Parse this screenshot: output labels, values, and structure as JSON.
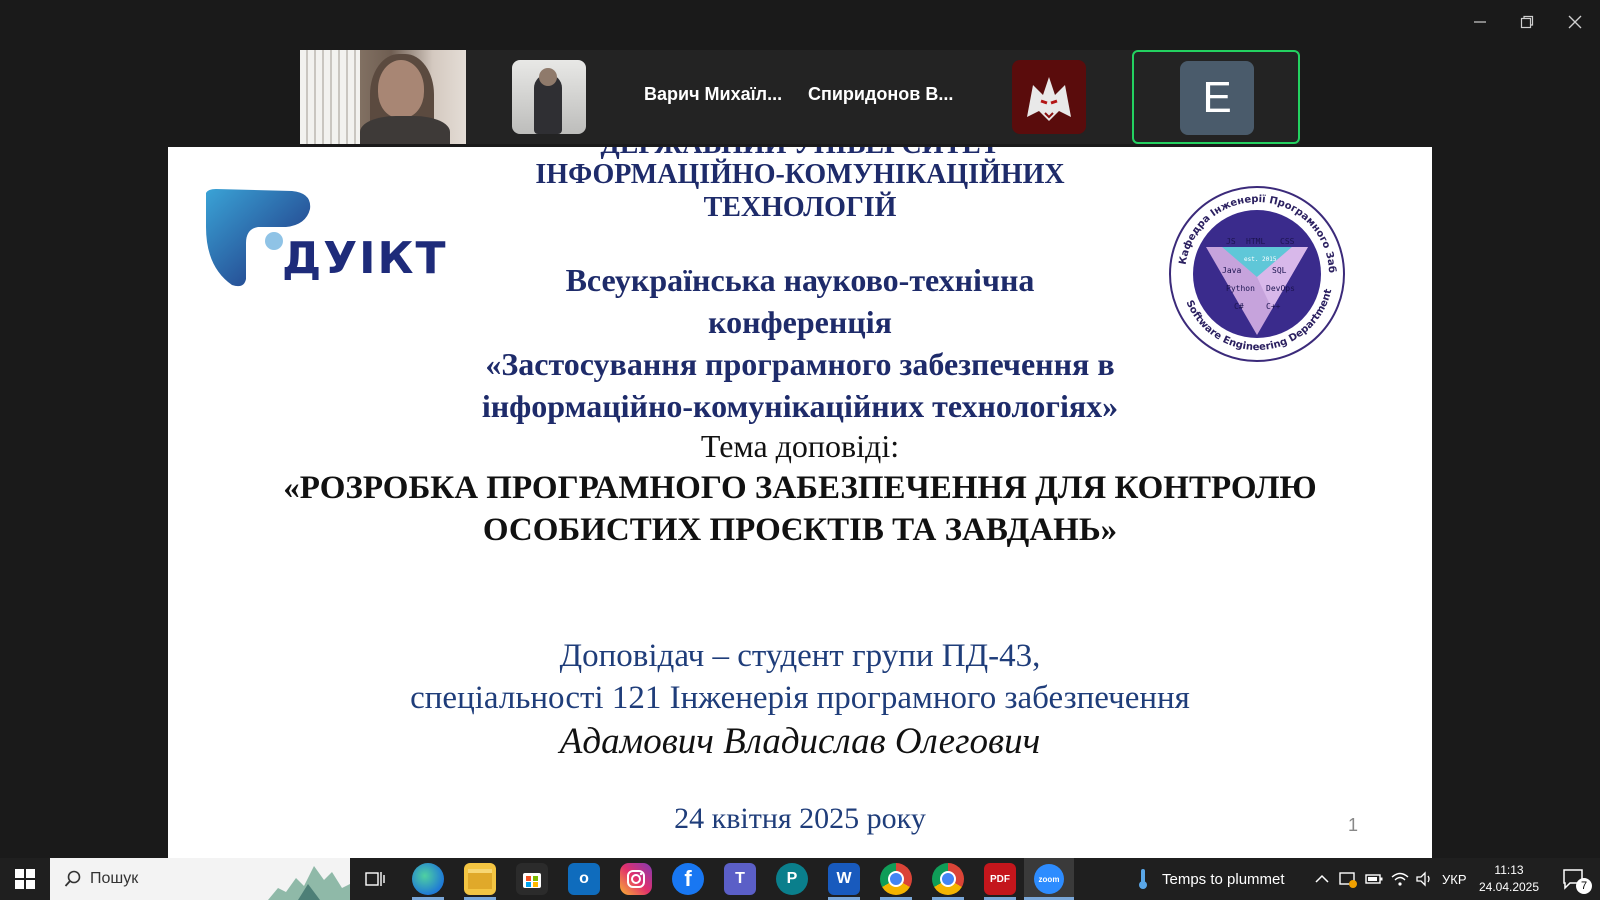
{
  "window": {
    "controls": {
      "minimize_icon": "minimize-icon",
      "restore_icon": "restore-icon",
      "close_icon": "close-icon"
    }
  },
  "participants": [
    {
      "type": "video",
      "name": ""
    },
    {
      "type": "photo",
      "name": ""
    },
    {
      "type": "name",
      "name": "Варич Михаїл..."
    },
    {
      "type": "name",
      "name": "Спиридонов В..."
    },
    {
      "type": "image",
      "name": ""
    },
    {
      "type": "letter",
      "letter": "E",
      "active": true
    }
  ],
  "slide": {
    "university_cut": "ДЕРЖАВНИЙ УНІВЕРСИТЕТ",
    "university_l2": "ІНФОРМАЦІЙНО-КОМУНІКАЦІЙНИХ",
    "university_l3": "ТЕХНОЛОГІЙ",
    "logo_text": "ДУІКТ",
    "conference_l1": "Всеукраїнська науково-технічна",
    "conference_l2": "конференція",
    "conference_l3": "«Застосування програмного забезпечення в",
    "conference_l4": "інформаційно-комунікаційних технологіях»",
    "topic_label": "Тема доповіді:",
    "topic_l1": "«РОЗРОБКА ПРОГРАМНОГО ЗАБЕЗПЕЧЕННЯ ДЛЯ КОНТРОЛЮ",
    "topic_l2": "ОСОБИСТИХ ПРОЄКТІВ ТА ЗАВДАНЬ»",
    "speaker_l1": "Доповідач – студент групи ПД-43,",
    "speaker_l2": "спеціальності 121 Інженерія програмного забезпечення",
    "speaker_name": "Адамович Владислав Олегович",
    "date": "24 квітня 2025 року",
    "page_number": "1",
    "dept_seal": {
      "ring_top": "Кафедра Інженерії Програмного Забезпечення",
      "ring_bottom": "Software Engineering Department",
      "labels": [
        "JS",
        "HTML",
        "CSS",
        "Java",
        "SQL",
        "Python",
        "DevOps",
        "C#",
        "C++"
      ],
      "est": "est. 2015"
    }
  },
  "taskbar": {
    "search_placeholder": "Пошук",
    "weather_text": "Temps to plummet",
    "language": "УКР",
    "time": "11:13",
    "date": "24.04.2025",
    "notification_count": "7",
    "apps": [
      "task-view",
      "edge",
      "file-explorer",
      "store",
      "outlook",
      "instagram",
      "facebook",
      "teams",
      "pearson",
      "word",
      "chrome",
      "chrome-profile",
      "pdf-editor",
      "zoom"
    ]
  }
}
